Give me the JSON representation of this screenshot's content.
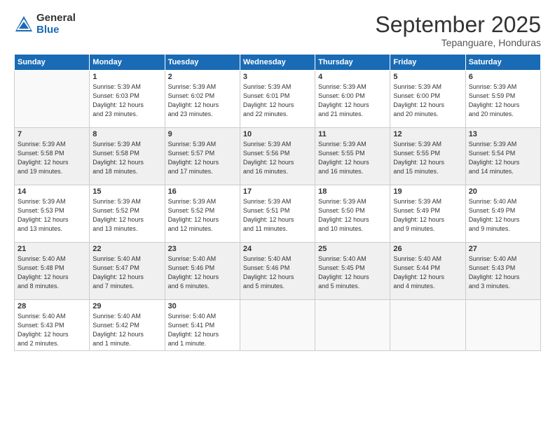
{
  "logo": {
    "general": "General",
    "blue": "Blue"
  },
  "title": "September 2025",
  "subtitle": "Tepanguare, Honduras",
  "headers": [
    "Sunday",
    "Monday",
    "Tuesday",
    "Wednesday",
    "Thursday",
    "Friday",
    "Saturday"
  ],
  "weeks": [
    [
      {
        "day": "",
        "info": ""
      },
      {
        "day": "1",
        "info": "Sunrise: 5:39 AM\nSunset: 6:03 PM\nDaylight: 12 hours\nand 23 minutes."
      },
      {
        "day": "2",
        "info": "Sunrise: 5:39 AM\nSunset: 6:02 PM\nDaylight: 12 hours\nand 23 minutes."
      },
      {
        "day": "3",
        "info": "Sunrise: 5:39 AM\nSunset: 6:01 PM\nDaylight: 12 hours\nand 22 minutes."
      },
      {
        "day": "4",
        "info": "Sunrise: 5:39 AM\nSunset: 6:00 PM\nDaylight: 12 hours\nand 21 minutes."
      },
      {
        "day": "5",
        "info": "Sunrise: 5:39 AM\nSunset: 6:00 PM\nDaylight: 12 hours\nand 20 minutes."
      },
      {
        "day": "6",
        "info": "Sunrise: 5:39 AM\nSunset: 5:59 PM\nDaylight: 12 hours\nand 20 minutes."
      }
    ],
    [
      {
        "day": "7",
        "info": "Sunrise: 5:39 AM\nSunset: 5:58 PM\nDaylight: 12 hours\nand 19 minutes."
      },
      {
        "day": "8",
        "info": "Sunrise: 5:39 AM\nSunset: 5:58 PM\nDaylight: 12 hours\nand 18 minutes."
      },
      {
        "day": "9",
        "info": "Sunrise: 5:39 AM\nSunset: 5:57 PM\nDaylight: 12 hours\nand 17 minutes."
      },
      {
        "day": "10",
        "info": "Sunrise: 5:39 AM\nSunset: 5:56 PM\nDaylight: 12 hours\nand 16 minutes."
      },
      {
        "day": "11",
        "info": "Sunrise: 5:39 AM\nSunset: 5:55 PM\nDaylight: 12 hours\nand 16 minutes."
      },
      {
        "day": "12",
        "info": "Sunrise: 5:39 AM\nSunset: 5:55 PM\nDaylight: 12 hours\nand 15 minutes."
      },
      {
        "day": "13",
        "info": "Sunrise: 5:39 AM\nSunset: 5:54 PM\nDaylight: 12 hours\nand 14 minutes."
      }
    ],
    [
      {
        "day": "14",
        "info": "Sunrise: 5:39 AM\nSunset: 5:53 PM\nDaylight: 12 hours\nand 13 minutes."
      },
      {
        "day": "15",
        "info": "Sunrise: 5:39 AM\nSunset: 5:52 PM\nDaylight: 12 hours\nand 13 minutes."
      },
      {
        "day": "16",
        "info": "Sunrise: 5:39 AM\nSunset: 5:52 PM\nDaylight: 12 hours\nand 12 minutes."
      },
      {
        "day": "17",
        "info": "Sunrise: 5:39 AM\nSunset: 5:51 PM\nDaylight: 12 hours\nand 11 minutes."
      },
      {
        "day": "18",
        "info": "Sunrise: 5:39 AM\nSunset: 5:50 PM\nDaylight: 12 hours\nand 10 minutes."
      },
      {
        "day": "19",
        "info": "Sunrise: 5:39 AM\nSunset: 5:49 PM\nDaylight: 12 hours\nand 9 minutes."
      },
      {
        "day": "20",
        "info": "Sunrise: 5:40 AM\nSunset: 5:49 PM\nDaylight: 12 hours\nand 9 minutes."
      }
    ],
    [
      {
        "day": "21",
        "info": "Sunrise: 5:40 AM\nSunset: 5:48 PM\nDaylight: 12 hours\nand 8 minutes."
      },
      {
        "day": "22",
        "info": "Sunrise: 5:40 AM\nSunset: 5:47 PM\nDaylight: 12 hours\nand 7 minutes."
      },
      {
        "day": "23",
        "info": "Sunrise: 5:40 AM\nSunset: 5:46 PM\nDaylight: 12 hours\nand 6 minutes."
      },
      {
        "day": "24",
        "info": "Sunrise: 5:40 AM\nSunset: 5:46 PM\nDaylight: 12 hours\nand 5 minutes."
      },
      {
        "day": "25",
        "info": "Sunrise: 5:40 AM\nSunset: 5:45 PM\nDaylight: 12 hours\nand 5 minutes."
      },
      {
        "day": "26",
        "info": "Sunrise: 5:40 AM\nSunset: 5:44 PM\nDaylight: 12 hours\nand 4 minutes."
      },
      {
        "day": "27",
        "info": "Sunrise: 5:40 AM\nSunset: 5:43 PM\nDaylight: 12 hours\nand 3 minutes."
      }
    ],
    [
      {
        "day": "28",
        "info": "Sunrise: 5:40 AM\nSunset: 5:43 PM\nDaylight: 12 hours\nand 2 minutes."
      },
      {
        "day": "29",
        "info": "Sunrise: 5:40 AM\nSunset: 5:42 PM\nDaylight: 12 hours\nand 1 minute."
      },
      {
        "day": "30",
        "info": "Sunrise: 5:40 AM\nSunset: 5:41 PM\nDaylight: 12 hours\nand 1 minute."
      },
      {
        "day": "",
        "info": ""
      },
      {
        "day": "",
        "info": ""
      },
      {
        "day": "",
        "info": ""
      },
      {
        "day": "",
        "info": ""
      }
    ]
  ]
}
